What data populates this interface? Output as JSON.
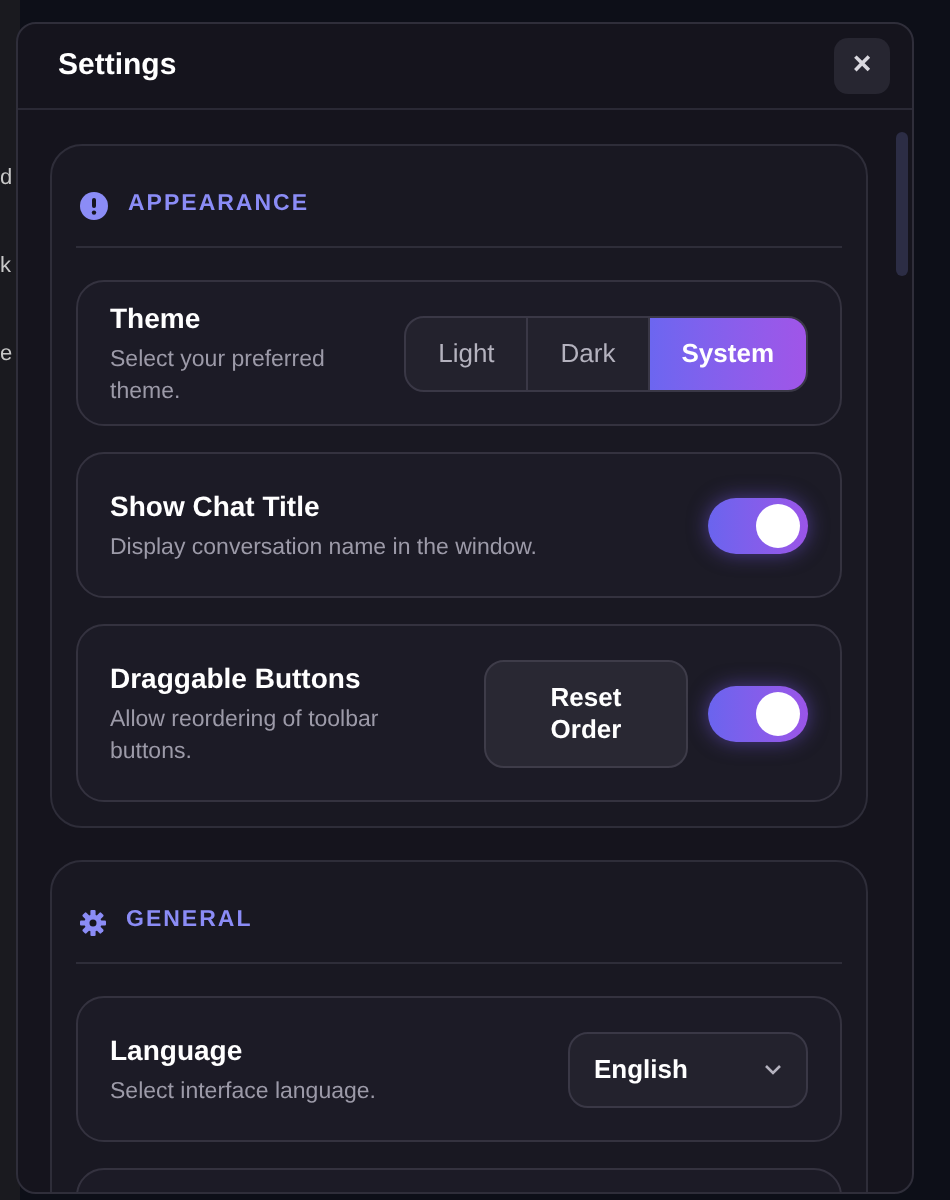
{
  "background": {
    "fragments": [
      "d",
      "k",
      "e"
    ]
  },
  "dialog": {
    "title": "Settings",
    "close": "×"
  },
  "sections": [
    {
      "title": "APPEARANCE",
      "rows": [
        {
          "kind": "segmented",
          "label": "Theme",
          "description": "Select your preferred theme.",
          "options": [
            {
              "label": "Light",
              "selected": false
            },
            {
              "label": "Dark",
              "selected": false
            },
            {
              "label": "System",
              "selected": true
            }
          ]
        },
        {
          "kind": "toggle",
          "label": "Show Chat Title",
          "description": "Display conversation name in the window.",
          "on": true
        },
        {
          "kind": "toggle",
          "label": "Draggable Buttons",
          "description": "Allow reordering of toolbar buttons.",
          "button": "Reset Order",
          "on": true
        }
      ]
    },
    {
      "title": "GENERAL",
      "rows": [
        {
          "kind": "select",
          "label": "Language",
          "description": "Select interface language.",
          "value": "English"
        },
        {
          "kind": "blank"
        }
      ]
    }
  ]
}
